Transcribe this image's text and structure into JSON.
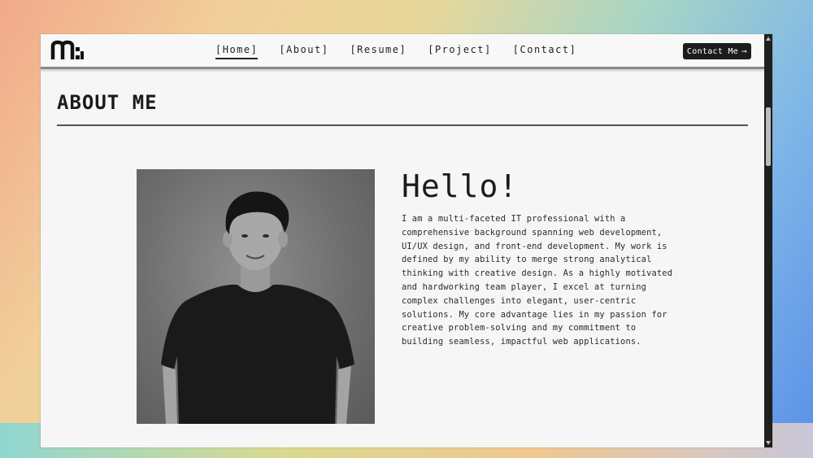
{
  "nav": {
    "items": [
      {
        "label": "[Home]",
        "active": true
      },
      {
        "label": "[About]",
        "active": false
      },
      {
        "label": "[Resume]",
        "active": false
      },
      {
        "label": "[Project]",
        "active": false
      },
      {
        "label": "[Contact]",
        "active": false
      }
    ],
    "cta_label": "Contact Me",
    "cta_icon": "arrow-right-icon"
  },
  "about": {
    "title": "ABOUT ME",
    "greeting": "Hello!",
    "bio": "I am a multi-faceted IT professional with a comprehensive background spanning web development, UI/UX design, and front-end development. My work is defined by my ability to merge strong analytical thinking with creative design. As a highly motivated and hardworking team player, I excel at turning complex challenges into elegant, user-centric solutions. My core advantage lies in my passion for creative problem-solving and my commitment to building seamless, impactful web applications."
  },
  "colors": {
    "accent_dark": "#1c1c1c",
    "page_bg": "#f6f6f6"
  }
}
